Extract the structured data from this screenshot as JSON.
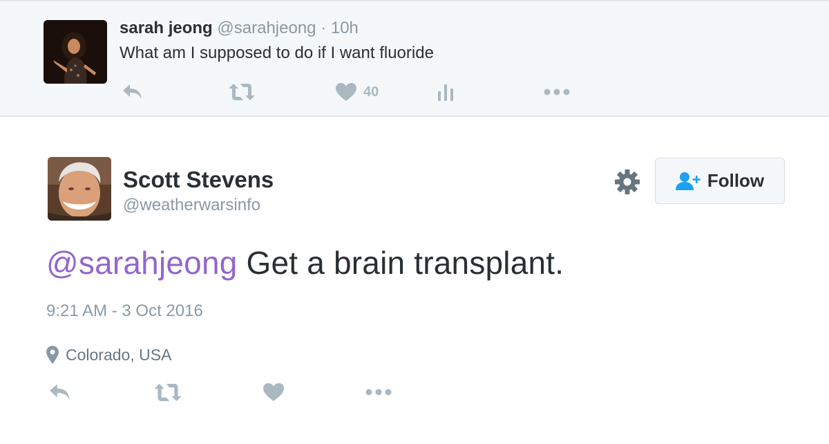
{
  "parent_tweet": {
    "name": "sarah jeong",
    "handle": "@sarahjeong",
    "separator": "·",
    "time": "10h",
    "text": "What am I supposed to do if I want fluoride",
    "like_count": "40",
    "actions": [
      "reply-icon",
      "retweet-icon",
      "heart-icon",
      "analytics-icon",
      "more-icon"
    ]
  },
  "main_tweet": {
    "author_name": "Scott Stevens",
    "author_handle": "@weatherwarsinfo",
    "follow_label": "Follow",
    "mention": "@sarahjeong",
    "text": " Get a brain transplant.",
    "timestamp": "9:21 AM - 3 Oct 2016",
    "location": "Colorado, USA",
    "actions": [
      "reply-icon",
      "retweet-icon",
      "heart-icon",
      "more-icon"
    ]
  },
  "colors": {
    "mention": "#9266cc",
    "muted_text": "#8899a6",
    "icon_gray": "#aab8c2",
    "follow_blue": "#1da1f2",
    "context_bg": "#f5f8fa"
  }
}
